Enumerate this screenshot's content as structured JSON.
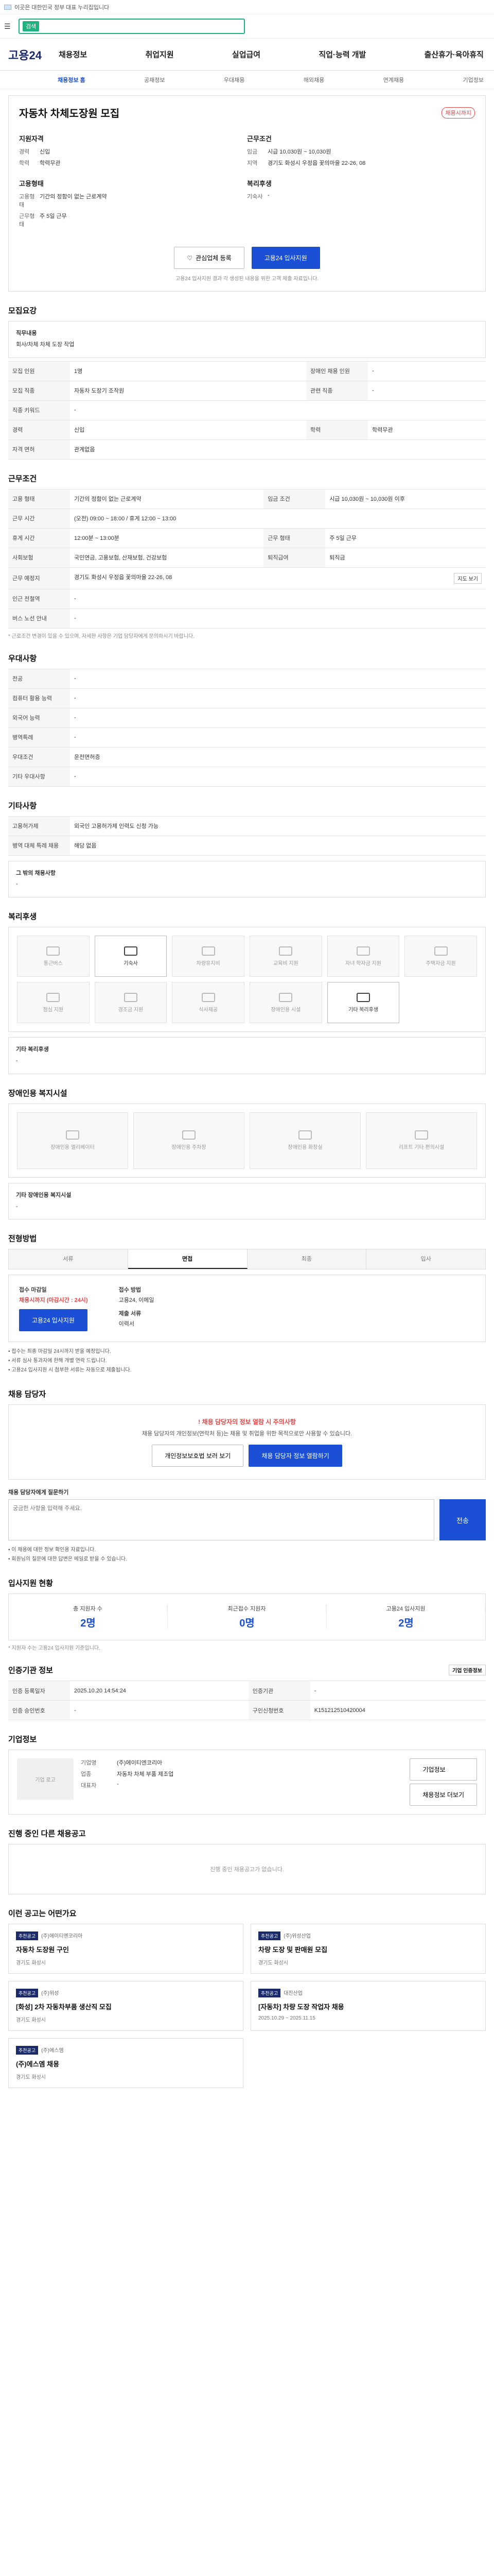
{
  "topbar": {
    "notice": "이곳은 대한민국 정부 대표 누리집입니다"
  },
  "search": {
    "tag": "검색"
  },
  "gnb": {
    "logo": "고용24",
    "items": [
      "채용정보",
      "취업지원",
      "실업급여",
      "직업·능력 개발",
      "출산휴가·육아휴직"
    ]
  },
  "subnav": [
    "채용정보 홈",
    "공채정보",
    "우대채용",
    "해외채용",
    "연계채용",
    "기업정보"
  ],
  "job": {
    "title": "자동차 차체도장원 모집",
    "badge": "채용시까지",
    "summary_left_head": "지원자격",
    "summary_left": [
      {
        "k": "경력",
        "v": "신입"
      },
      {
        "k": "학력",
        "v": "학력무관"
      }
    ],
    "summary_left2_head": "고용형태",
    "summary_left2": [
      {
        "k": "고용형태",
        "v": "기간의 정함이 없는 근로계약"
      },
      {
        "k": "근무형태",
        "v": "주 5일 근무"
      }
    ],
    "summary_right_head": "근무조건",
    "summary_right": [
      {
        "k": "임금",
        "v": "시급 10,030원 ~ 10,030원"
      },
      {
        "k": "지역",
        "v": "경기도 화성시 우정읍 꽃의마을 22-26, 08"
      }
    ],
    "summary_right2_head": "복리후생",
    "summary_right2": [
      {
        "k": "기숙사",
        "v": "-"
      }
    ],
    "btn_scrap": "관심업체 등록",
    "btn_apply": "고용24 입사지원",
    "apply_note": "고용24 입사지원 결과 각 생성된 내용을 위한 고객 제출 자료입니다."
  },
  "sections": {
    "recruit": "모집요강",
    "work": "근무조건",
    "pref": "우대사항",
    "other": "기타사항",
    "welfare": "복리후생",
    "disabled": "장애인용 복지시설",
    "process": "전형방법",
    "contact": "채용 담당자",
    "stats": "입사지원 현황",
    "agency": "인증기관 정보",
    "company": "기업정보",
    "other_jobs": "진행 중인 다른 채용공고",
    "recommend": "이런 공고는 어떤가요"
  },
  "recruit": {
    "duty_head": "직무내용",
    "duty": "회사/차체 차체 도장 작업",
    "rows": [
      [
        "모집 인원",
        "1명",
        "장애인 채용 인원",
        "-"
      ],
      [
        "모집 직종",
        "자동차 도장기 조작원",
        "관련 직종",
        "-"
      ],
      [
        "직종 키워드",
        "-",
        "",
        ""
      ],
      [
        "경력",
        "신입",
        "학력",
        "학력무관"
      ],
      [
        "자격 면허",
        "관계없음",
        "",
        ""
      ]
    ]
  },
  "work": {
    "rows": [
      [
        "고용 형태",
        "기간의 정함이 없는 근로계약",
        "임금 조건",
        "시급 10,030원 ~ 10,030원 이후"
      ],
      [
        "근무 시간",
        "(오전) 09:00 ~ 18:00 / 휴게 12:00 ~ 13:00",
        "",
        ""
      ],
      [
        "휴게 시간",
        "12:00분 ~ 13:00분",
        "근무 형태",
        "주 5일 근무"
      ],
      [
        "사회보험",
        "국민연금, 고용보험, 산재보험, 건강보험",
        "퇴직급여",
        "퇴직금"
      ],
      [
        "근무 예정지",
        "경기도 화성시 우정읍 꽃의마을 22-26, 08",
        "",
        ""
      ],
      [
        "인근 전철역",
        "-",
        "",
        ""
      ],
      [
        "버스 노선 안내",
        "-",
        "",
        ""
      ]
    ],
    "map_btn": "지도 보기",
    "note": "* 근로조건 변경이 있을 수 있으며, 자세한 사항은 기업 담당자에게 문의하시기 바랍니다."
  },
  "pref": {
    "rows": [
      [
        "전공",
        "-"
      ],
      [
        "컴퓨터 활용 능력",
        "-"
      ],
      [
        "외국어 능력",
        "-"
      ],
      [
        "병역특례",
        "-"
      ],
      [
        "우대조건",
        "운전면허증"
      ],
      [
        "기타 우대사항",
        "-"
      ]
    ]
  },
  "other": {
    "rows": [
      [
        "고용허가제",
        "외국인 고용허가제 인력도 신청 가능"
      ],
      [
        "병역 대체 특례 채용",
        "해당 없음"
      ]
    ],
    "extra_head": "그 밖의 채용사항",
    "extra": "-"
  },
  "welfare": {
    "items": [
      {
        "name": "통근버스",
        "on": false
      },
      {
        "name": "기숙사",
        "on": true
      },
      {
        "name": "차량유지비",
        "on": false
      },
      {
        "name": "교육비 지원",
        "on": false
      },
      {
        "name": "자녀 학자금 지원",
        "on": false
      },
      {
        "name": "주택자금 지원",
        "on": false
      },
      {
        "name": "점심 지원",
        "on": false
      },
      {
        "name": "경조금 지원",
        "on": false
      },
      {
        "name": "식사제공",
        "on": false
      },
      {
        "name": "장애인용 시설",
        "on": false
      },
      {
        "name": "기타 복리후생",
        "on": true
      },
      {
        "name": "",
        "on": false
      }
    ],
    "extra_head": "기타 복리후생",
    "extra": "-"
  },
  "disabled": {
    "items": [
      "장애인용 엘리베이터",
      "장애인용 주차장",
      "장애인용 화장실",
      "리프트 기타 편의시설"
    ],
    "extra_head": "기타 장애인용 복지시설",
    "extra": "-"
  },
  "process": {
    "steps": [
      "서류",
      "면접",
      "최종",
      "입사"
    ],
    "how_label": "접수 마감일",
    "how_val": "채용시까지 (마감시간 : 24시)",
    "method_label": "접수 방법",
    "method_val": "고용24, 이메일",
    "doc_label": "제출 서류",
    "doc_val": "이력서",
    "apply_btn": "고용24 입사지원",
    "bullets": [
      "접수는 최종 마감일 24시까지 받을 예정입니다.",
      "서류 심사 통과자에 한해 개별 연락 드립니다.",
      "고용24 입사지원 시 첨부한 서류는 자동으로 제출됩니다."
    ]
  },
  "contact": {
    "warn_head": "채용 담당자의 정보 열람 시 주의사항",
    "warn": "채용 담당자의 개인정보(연락처 등)는 채용 및 취업을 위한 목적으로만 사용할 수 있습니다.",
    "btn1": "개인정보보호법 보러 보기",
    "btn2": "채용 담당자 정보 열람하기",
    "qa_label": "채용 담당자에게 질문하기",
    "qa_placeholder": "궁금한 사항을 입력해 주세요.",
    "send": "전송",
    "bullets": [
      "이 채용에 대한 정보 확인용 자료입니다.",
      "회원님의 질문에 대한 답변은 메일로 받을 수 있습니다."
    ]
  },
  "stats": {
    "items": [
      {
        "l": "총 지원자 수",
        "n": "2명"
      },
      {
        "l": "최근접수 지원자",
        "n": "0명"
      },
      {
        "l": "고용24 입사지원",
        "n": "2명"
      }
    ],
    "note": "* 지원자 수는 고용24 입사지원 기준입니다."
  },
  "agency": {
    "btn": "기업 인증정보",
    "rows": [
      [
        "인증 등록일자",
        "2025.10.20 14:54:24",
        "인증기관",
        "-"
      ],
      [
        "인증 승인번호",
        "-",
        "구인신청번호",
        "K151212510420004"
      ]
    ]
  },
  "company": {
    "logo_alt": "기업 로고",
    "rows": [
      [
        "기업명",
        "(주)에이티엔코리아"
      ],
      [
        "업종",
        "자동차 차체 부품 제조업"
      ],
      [
        "대표자",
        "-"
      ]
    ],
    "btn1": "기업정보",
    "btn2": "채용정보 더보기"
  },
  "other_jobs": {
    "empty": "진행 중인 채용공고가 없습니다."
  },
  "recs": [
    {
      "tag": "추천공고",
      "comp": "(주)에이티엔코리아",
      "title": "자동차 도장원 구인",
      "meta": "경기도 화성시"
    },
    {
      "tag": "추천공고",
      "comp": "(주)위성산업",
      "title": "차량 도장 및 판매원 모집",
      "meta": "경기도 화성시"
    },
    {
      "tag": "추천공고",
      "comp": "(주)위성",
      "title": "[화성] 2차 자동차부품 생산직 모집",
      "meta": "경기도 화성시"
    },
    {
      "tag": "추천공고",
      "comp": "대진산업",
      "title": "[자동차] 차량 도장 작업자 채용",
      "meta": "2025.10.29 ~ 2025.11.15"
    },
    {
      "tag": "추천공고",
      "comp": "(주)에스엠",
      "title": "(주)에스엠 채용",
      "meta": "경기도 화성시"
    }
  ]
}
